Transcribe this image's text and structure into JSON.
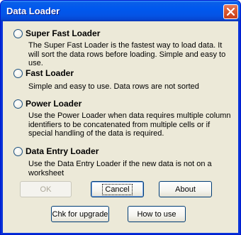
{
  "window": {
    "title": "Data Loader"
  },
  "options": [
    {
      "label": "Super Fast Loader",
      "description": "The Super Fast Loader is the fastest way to load data.  It will sort the data rows before loading. Simple and easy to use."
    },
    {
      "label": "Fast Loader",
      "description": "Simple and easy to use. Data rows are not sorted"
    },
    {
      "label": "Power Loader",
      "description": "Use the Power Loader when data requires multiple column identifiers to be concatenated from multiple cells or if special handling of the data is required."
    },
    {
      "label": "Data Entry Loader",
      "description": "Use the Data Entry Loader if the new data is not on a worksheet"
    }
  ],
  "buttons": {
    "ok": "OK",
    "cancel": "Cancel",
    "about": "About",
    "check_upgrade": "Chk for upgrade",
    "how_to_use": "How to use"
  },
  "colors": {
    "titlebar": "#0058ee",
    "dialog_bg": "#ece9d8",
    "close_button": "#d8582f"
  },
  "icons": {
    "close": "close-icon"
  }
}
